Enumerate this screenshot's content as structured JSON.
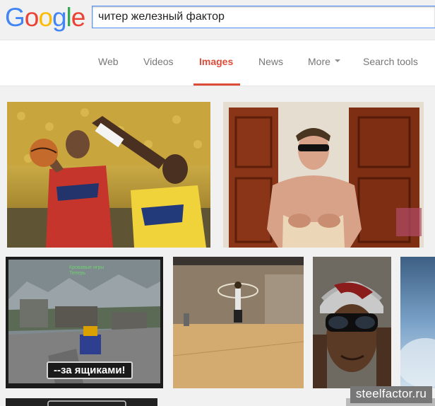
{
  "logo": {
    "letters": [
      "G",
      "o",
      "o",
      "g",
      "l",
      "e"
    ],
    "colors": [
      "#4285f4",
      "#ea4335",
      "#fbbc05",
      "#4285f4",
      "#34a853",
      "#ea4335"
    ]
  },
  "search": {
    "query": "читер железный фактор"
  },
  "tabs": [
    {
      "label": "Web",
      "active": false
    },
    {
      "label": "Videos",
      "active": false
    },
    {
      "label": "Images",
      "active": true
    },
    {
      "label": "News",
      "active": false
    },
    {
      "label": "More",
      "active": false,
      "dropdown": true
    },
    {
      "label": "Search tools",
      "active": false
    }
  ],
  "accent_color": "#dd4b39",
  "results": [
    {
      "subject": "basketball-players"
    },
    {
      "subject": "shirtless-man-sunglasses"
    },
    {
      "subject": "game-screenshot",
      "caption": "--за ящиками!",
      "hud_lines": [
        "Кровавые игры",
        "Теперь"
      ]
    },
    {
      "subject": "gym-floor"
    },
    {
      "subject": "man-with-beanie"
    },
    {
      "subject": "sky"
    }
  ],
  "watermark": "steelfactor.ru"
}
